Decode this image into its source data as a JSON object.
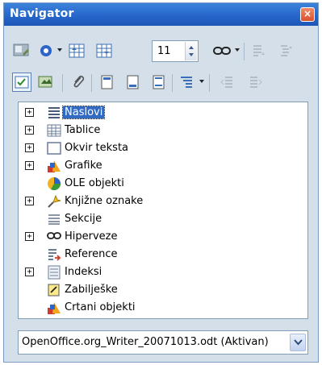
{
  "window": {
    "title": "Navigator",
    "close_glyph": "×"
  },
  "toolbar1": {
    "items": [
      "content-view-icon",
      "navigation-icon",
      "previous-icon",
      "next-icon",
      "page-number-spinner",
      "drag-mode-icon",
      "promote-level-icon",
      "demote-level-icon"
    ],
    "page_number": "11"
  },
  "toolbar2": {
    "items": [
      "list-box-toggle-icon",
      "headings-view-icon",
      "reminder-icon",
      "header-icon",
      "footer-icon",
      "anchor-icon",
      "heading-levels-icon",
      "promote-chapter-icon",
      "demote-chapter-icon"
    ]
  },
  "tree": {
    "items": [
      {
        "label": "Naslovi",
        "expandable": true,
        "selected": true,
        "icon": "headings-icon"
      },
      {
        "label": "Tablice",
        "expandable": true,
        "icon": "tables-icon"
      },
      {
        "label": "Okvir teksta",
        "expandable": true,
        "icon": "text-frame-icon"
      },
      {
        "label": "Grafike",
        "expandable": true,
        "icon": "graphics-icon"
      },
      {
        "label": "OLE objekti",
        "expandable": false,
        "icon": "ole-objects-icon"
      },
      {
        "label": "Knjižne oznake",
        "expandable": true,
        "icon": "bookmarks-icon"
      },
      {
        "label": "Sekcije",
        "expandable": false,
        "icon": "sections-icon"
      },
      {
        "label": "Hiperveze",
        "expandable": true,
        "icon": "hyperlinks-icon"
      },
      {
        "label": "Reference",
        "expandable": false,
        "icon": "references-icon"
      },
      {
        "label": "Indeksi",
        "expandable": true,
        "icon": "indexes-icon"
      },
      {
        "label": "Zabilješke",
        "expandable": false,
        "icon": "comments-icon"
      },
      {
        "label": "Crtani objekti",
        "expandable": false,
        "icon": "drawing-objects-icon"
      }
    ],
    "expand_glyph": "+"
  },
  "document_selector": {
    "value": "OpenOffice.org_Writer_20071013.odt (Aktivan)"
  },
  "colors": {
    "title_bar": "#2564c8",
    "selection": "#316ac5",
    "panel": "#d4dfe9"
  }
}
